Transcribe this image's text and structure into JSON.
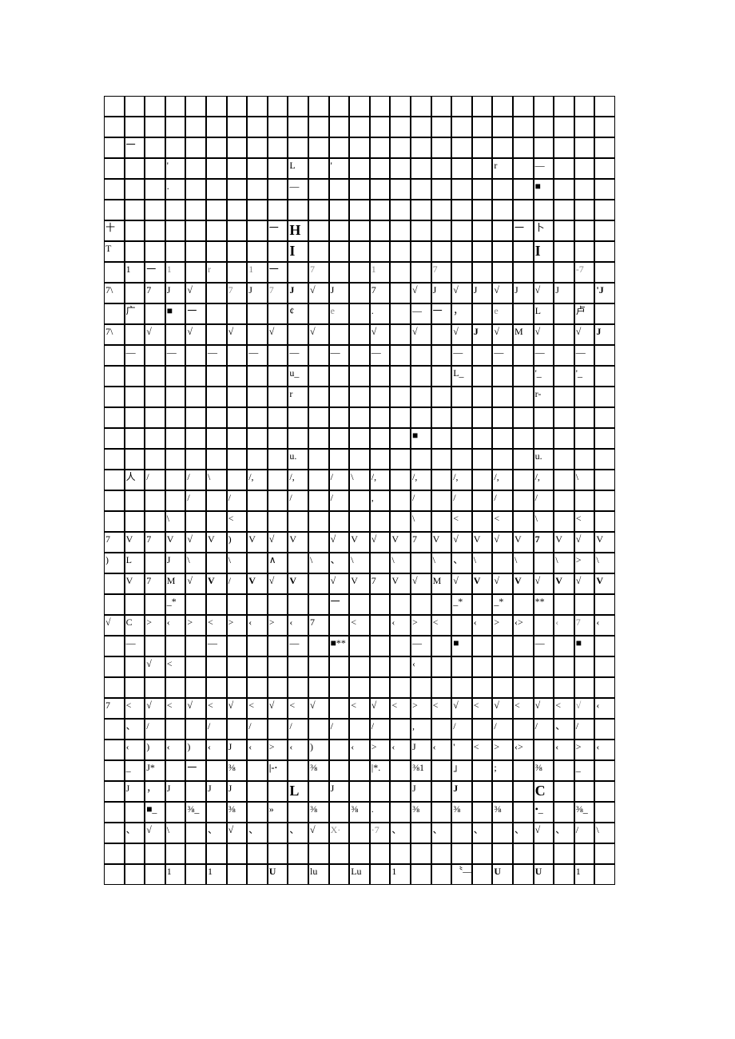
{
  "rows": [
    [
      "",
      "",
      "",
      "",
      "",
      "",
      "",
      "",
      "",
      "",
      "",
      "",
      "",
      "",
      "",
      "",
      "",
      "",
      "",
      "",
      "",
      "",
      "",
      "",
      ""
    ],
    [
      "",
      "",
      "",
      "",
      "",
      "",
      "",
      "",
      "",
      "",
      "",
      "",
      "",
      "",
      "",
      "",
      "",
      "",
      "",
      "",
      "",
      "",
      "",
      "",
      ""
    ],
    [
      "",
      "一",
      "",
      "",
      "",
      "",
      "",
      "",
      "",
      "",
      "",
      "",
      "",
      "",
      "",
      "",
      "",
      "",
      "",
      "",
      "",
      "",
      "",
      "",
      ""
    ],
    [
      "",
      "",
      "",
      "'",
      "",
      "",
      "",
      "",
      "",
      "L",
      "",
      "'",
      "",
      "",
      "",
      "",
      "",
      "",
      "",
      "r",
      "",
      "—",
      "",
      "",
      ""
    ],
    [
      "",
      "",
      "",
      ".",
      "",
      "",
      "",
      "",
      "",
      "—",
      "",
      "",
      "",
      "",
      "",
      "",
      "",
      "",
      "",
      "",
      "",
      "■",
      "",
      "",
      ""
    ],
    [
      "",
      "",
      "",
      "",
      "",
      "",
      "",
      "",
      "",
      "",
      "",
      "",
      "",
      "",
      "",
      "",
      "",
      "",
      "",
      "",
      "",
      "",
      "",
      "",
      ""
    ],
    [
      "十",
      "",
      "",
      "",
      "",
      "",
      "",
      "",
      "一",
      "H",
      "",
      "",
      "",
      "",
      "",
      "",
      "",
      "",
      "",
      "",
      "一",
      "卜",
      "",
      "",
      ""
    ],
    [
      "T",
      "",
      "",
      "",
      "",
      "",
      "",
      "",
      "",
      "I",
      "",
      "",
      "",
      "",
      "",
      "",
      "",
      "",
      "",
      "",
      "",
      "I",
      "",
      "",
      ""
    ],
    [
      "",
      "1",
      "一",
      "1",
      "",
      "r",
      "",
      "1",
      "一",
      "",
      "7",
      "",
      "",
      "1",
      "",
      "",
      "7",
      "",
      "",
      "",
      "",
      "",
      "",
      "-7",
      ""
    ],
    [
      "7\\",
      "",
      "7",
      "J",
      "√",
      "",
      "7",
      "J",
      "7",
      "J",
      "√",
      "J",
      "",
      "7",
      "",
      "√",
      "J",
      "√",
      "J",
      "√",
      "J",
      "√",
      "J",
      "",
      "'J"
    ],
    [
      "",
      "广",
      "",
      "■",
      "一",
      "",
      "",
      "",
      "",
      "¢",
      "",
      "e",
      "",
      ".",
      "",
      "—",
      "一",
      "，",
      "",
      "e",
      "",
      "L",
      "",
      "卢",
      ""
    ],
    [
      "7\\",
      "",
      "√",
      "",
      "√",
      "",
      "√",
      "",
      "√",
      "",
      "√",
      "",
      "",
      "√",
      "",
      "√",
      "",
      "√",
      "J",
      "√",
      "M",
      "√",
      "",
      "√",
      "J"
    ],
    [
      "",
      "—",
      "",
      "—",
      "",
      "—",
      "",
      "—",
      "",
      "—",
      "",
      "—",
      "",
      "—",
      "",
      "",
      "",
      "—",
      "",
      "—",
      "",
      "—",
      "",
      "—",
      ""
    ],
    [
      "",
      "",
      "",
      "",
      "",
      "",
      "",
      "",
      "",
      "u_",
      "",
      "",
      "",
      "",
      "",
      "",
      "",
      "L_",
      "",
      "",
      "",
      "'_",
      "",
      "'_",
      ""
    ],
    [
      "",
      "",
      "",
      "",
      "",
      "",
      "",
      "",
      "",
      "r",
      "",
      "",
      "",
      "",
      "",
      "",
      "",
      "",
      "",
      "",
      "",
      "r-",
      "",
      "",
      ""
    ],
    [
      "",
      "",
      "",
      "",
      "",
      "",
      "",
      "",
      "",
      "",
      "",
      "",
      "",
      "",
      "",
      "",
      "",
      "",
      "",
      "",
      "",
      "",
      "",
      "",
      ""
    ],
    [
      "",
      "",
      "",
      "",
      "",
      "",
      "",
      "",
      "",
      "",
      "",
      "",
      "",
      "",
      "",
      "■",
      "",
      "",
      "",
      "",
      "",
      "",
      "",
      "",
      ""
    ],
    [
      "",
      "",
      "",
      "",
      "",
      "",
      "",
      "",
      "",
      "u.",
      "",
      "",
      "",
      "",
      "",
      "",
      "",
      "",
      "",
      "",
      "",
      "u.",
      "",
      "",
      ""
    ],
    [
      "",
      "人",
      "/",
      "",
      "/",
      "\\",
      "",
      "/,",
      "",
      "/,",
      "",
      "/",
      "\\",
      "/,",
      "",
      "/,",
      "",
      "/,",
      "",
      "/,",
      "",
      "/,",
      "",
      "\\",
      ""
    ],
    [
      "",
      "",
      "",
      "",
      "/",
      "",
      "/",
      "",
      "",
      "/",
      "",
      "/",
      "",
      ",",
      "",
      "/",
      "",
      "/",
      "",
      "/",
      "",
      "/",
      "",
      "",
      ""
    ],
    [
      "",
      "",
      "",
      "\\",
      "",
      "",
      "<",
      "",
      "",
      "",
      "",
      "",
      "",
      "",
      "",
      "\\",
      "",
      "<",
      "",
      "<",
      "",
      "\\",
      "",
      "<",
      ""
    ],
    [
      "7",
      "V",
      "7",
      "V",
      "√",
      "V",
      ")",
      "V",
      "√",
      "V",
      "",
      "√",
      "V",
      "√",
      "V",
      "7",
      "V",
      "√",
      "V",
      "√",
      "V",
      "7",
      "V",
      "√",
      "V"
    ],
    [
      ")",
      "L",
      "",
      "J",
      "\\",
      "",
      "\\",
      "",
      "∧",
      "",
      "\\",
      "、",
      "\\",
      "",
      "\\",
      "",
      "\\",
      "、",
      "\\",
      "",
      "\\",
      "",
      "\\",
      ">",
      "\\"
    ],
    [
      "",
      "V",
      "7",
      "M",
      "√",
      "V",
      "/",
      "V",
      "√",
      "V",
      "",
      "√",
      "V",
      "7",
      "V",
      "√",
      "M",
      "√",
      "V",
      "√",
      "V",
      "√",
      "V",
      "√",
      "V"
    ],
    [
      "",
      "",
      "",
      "_*",
      "",
      "",
      "",
      "",
      "",
      "",
      "",
      "一",
      "",
      "",
      "",
      "",
      "",
      "_*",
      "",
      "_*",
      "",
      "**",
      "",
      "",
      ""
    ],
    [
      "√",
      "C",
      ">",
      "‹",
      ">",
      "<",
      ">",
      "‹",
      ">",
      "‹",
      "7",
      "",
      "<",
      "",
      "‹",
      ">",
      "<",
      "",
      "‹",
      ">",
      "‹>",
      "",
      "‹",
      "7",
      "‹"
    ],
    [
      "",
      "—",
      "",
      "",
      "",
      "—",
      "",
      "",
      "",
      "—",
      "",
      "■**",
      "",
      "",
      "",
      "—",
      "",
      "■",
      "",
      "",
      "",
      "—",
      "",
      "■",
      ""
    ],
    [
      "",
      "",
      "√",
      "<",
      "",
      "",
      "",
      "",
      "",
      "",
      "",
      "",
      "",
      "",
      "",
      "‹",
      "",
      "",
      "",
      "",
      "",
      "",
      "",
      "",
      ""
    ],
    [
      "",
      "",
      "",
      "",
      "",
      "",
      "",
      "",
      "",
      "",
      "",
      "",
      "",
      "",
      "",
      "",
      "",
      "",
      "",
      "",
      "",
      "",
      "",
      "",
      ""
    ],
    [
      "7",
      "<",
      "√",
      "<",
      "√",
      "<",
      "√",
      "<",
      "√",
      "<",
      "√",
      "",
      "<",
      "√",
      "<",
      ">",
      "<",
      "√",
      "<",
      "√",
      "<",
      "√",
      "<",
      "√",
      "‹"
    ],
    [
      "",
      "、",
      "/",
      "",
      "",
      "/",
      "",
      "/",
      "",
      "/",
      "",
      "/",
      "",
      "/",
      "",
      ",",
      "",
      "/",
      "",
      "/",
      "",
      "/",
      "、",
      "/",
      ""
    ],
    [
      "",
      "‹",
      ")",
      "‹",
      ")",
      "‹",
      "J",
      "‹",
      ">",
      "‹",
      ")",
      "",
      "‹",
      ">",
      "‹",
      "J",
      "‹",
      "'",
      "<",
      ">",
      "‹>",
      "",
      "‹",
      ">",
      "‹"
    ],
    [
      "",
      "_",
      "J*",
      "",
      "一",
      "",
      "⅜",
      "",
      "|-·",
      "",
      "⅜",
      "",
      "",
      "|*.",
      "",
      "⅜1",
      "",
      "」",
      "",
      ";",
      "",
      "⅜",
      "",
      "_",
      ""
    ],
    [
      "",
      "J",
      "，",
      "J",
      "",
      "J",
      "J",
      "",
      "",
      "L",
      "",
      "J",
      "",
      "",
      "",
      "J",
      "",
      "J",
      "",
      "",
      "",
      "C",
      "",
      "",
      ""
    ],
    [
      "",
      "",
      "■_",
      "",
      "⅜_",
      "",
      "⅜",
      "",
      "»",
      "",
      "⅜",
      "",
      "⅜",
      ".",
      "",
      "⅜",
      "",
      "⅜",
      "",
      "⅜",
      "",
      "•_",
      "",
      "⅜_",
      ""
    ],
    [
      "",
      "、",
      "√",
      "\\",
      "",
      "、",
      "√",
      "、",
      "",
      "、",
      "√",
      "X·",
      "",
      "·7",
      "、",
      "",
      "、",
      "",
      "、",
      "",
      "、",
      "√",
      "、",
      "/",
      "\\"
    ],
    [
      "",
      "",
      "",
      "",
      "",
      "",
      "",
      "",
      "",
      "",
      "",
      "",
      "",
      "",
      "",
      "",
      "",
      "",
      "",
      "",
      "",
      "",
      "",
      "",
      ""
    ],
    [
      "",
      "",
      "",
      "1",
      "",
      "1",
      "",
      "",
      "U",
      "",
      "lu",
      "",
      "Lu",
      "",
      "1",
      "",
      "",
      "〝—",
      "",
      "U",
      "",
      "U",
      "",
      "1",
      ""
    ]
  ],
  "boldCells": {
    "6-9": true,
    "7-9": true,
    "7-21": true,
    "9-9": true,
    "9-17": true,
    "9-21": true,
    "9-24": true,
    "11-18": true,
    "11-24": true,
    "21-19": true,
    "21-21": true,
    "23-5": true,
    "23-7": true,
    "23-9": true,
    "23-18": true,
    "23-20": true,
    "23-22": true,
    "23-24": true,
    "32-8": true,
    "33-9": true,
    "33-17": true,
    "33-21": true,
    "37-8": true,
    "37-19": true,
    "37-21": true
  },
  "bigCells": {
    "6-9": true,
    "7-9": true,
    "7-21": true,
    "33-9": true,
    "33-21": true
  },
  "grayCells": {
    "8-3": true,
    "8-5": true,
    "8-7": true,
    "8-10": true,
    "8-13": true,
    "8-16": true,
    "8-23": true,
    "9-6": true,
    "9-8": true,
    "10-11": true,
    "10-19": true,
    "25-22": true,
    "25-23": true,
    "29-23": true,
    "35-11": true,
    "35-13": true
  }
}
